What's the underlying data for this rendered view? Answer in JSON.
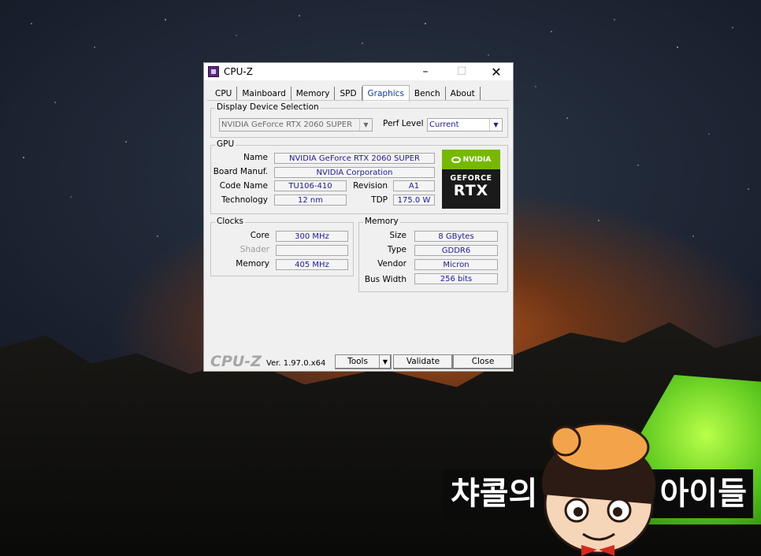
{
  "window": {
    "title": "CPU-Z",
    "minimize_icon": "–",
    "maximize_icon": "☐",
    "close_icon": "✕"
  },
  "tabs": [
    "CPU",
    "Mainboard",
    "Memory",
    "SPD",
    "Graphics",
    "Bench",
    "About"
  ],
  "active_tab": "Graphics",
  "display_device": {
    "legend": "Display Device Selection",
    "device": "NVIDIA GeForce RTX 2060 SUPER",
    "perf_level_label": "Perf Level",
    "perf_level_value": "Current"
  },
  "gpu": {
    "legend": "GPU",
    "name_label": "Name",
    "name": "NVIDIA GeForce RTX 2060 SUPER",
    "board_label": "Board Manuf.",
    "board": "NVIDIA Corporation",
    "code_label": "Code Name",
    "code": "TU106-410",
    "revision_label": "Revision",
    "revision": "A1",
    "tech_label": "Technology",
    "tech": "12 nm",
    "tdp_label": "TDP",
    "tdp": "175.0 W",
    "logo": {
      "brand": "NVIDIA",
      "line1": "GEFORCE",
      "line2": "RTX"
    }
  },
  "clocks": {
    "legend": "Clocks",
    "core_label": "Core",
    "core": "300 MHz",
    "shader_label": "Shader",
    "shader": "",
    "memory_label": "Memory",
    "memory": "405 MHz"
  },
  "memory": {
    "legend": "Memory",
    "size_label": "Size",
    "size": "8 GBytes",
    "type_label": "Type",
    "type": "GDDR6",
    "vendor_label": "Vendor",
    "vendor": "Micron",
    "bus_label": "Bus Width",
    "bus": "256 bits"
  },
  "footer": {
    "brand": "CPU-Z",
    "version": "Ver. 1.97.0.x64",
    "tools_label": "Tools",
    "validate_label": "Validate",
    "close_label": "Close"
  },
  "watermark": {
    "left_text": "챠콜의",
    "right_text": "아이들"
  }
}
